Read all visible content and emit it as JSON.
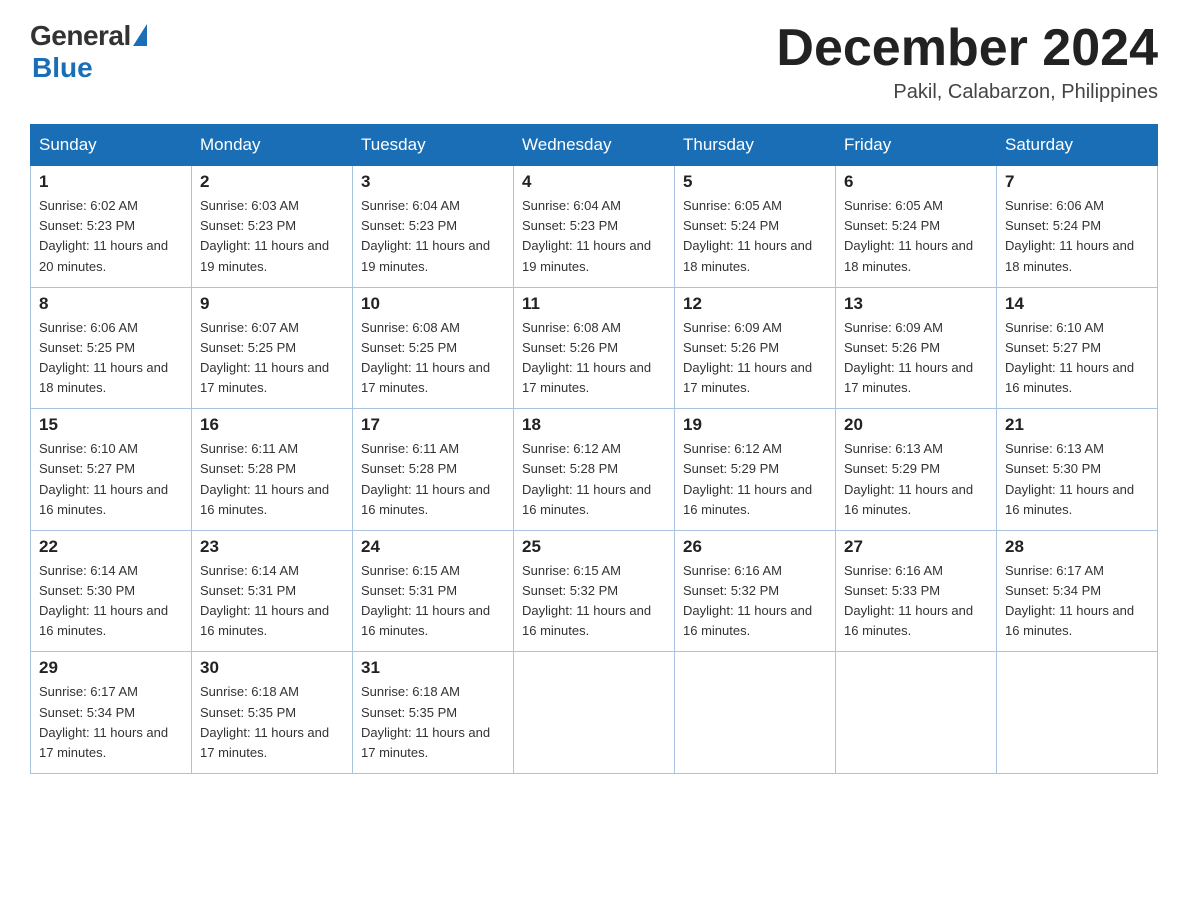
{
  "header": {
    "logo_general": "General",
    "logo_blue": "Blue",
    "month_title": "December 2024",
    "location": "Pakil, Calabarzon, Philippines"
  },
  "days_of_week": [
    "Sunday",
    "Monday",
    "Tuesday",
    "Wednesday",
    "Thursday",
    "Friday",
    "Saturday"
  ],
  "weeks": [
    [
      {
        "day": "1",
        "sunrise": "6:02 AM",
        "sunset": "5:23 PM",
        "daylight": "11 hours and 20 minutes."
      },
      {
        "day": "2",
        "sunrise": "6:03 AM",
        "sunset": "5:23 PM",
        "daylight": "11 hours and 19 minutes."
      },
      {
        "day": "3",
        "sunrise": "6:04 AM",
        "sunset": "5:23 PM",
        "daylight": "11 hours and 19 minutes."
      },
      {
        "day": "4",
        "sunrise": "6:04 AM",
        "sunset": "5:23 PM",
        "daylight": "11 hours and 19 minutes."
      },
      {
        "day": "5",
        "sunrise": "6:05 AM",
        "sunset": "5:24 PM",
        "daylight": "11 hours and 18 minutes."
      },
      {
        "day": "6",
        "sunrise": "6:05 AM",
        "sunset": "5:24 PM",
        "daylight": "11 hours and 18 minutes."
      },
      {
        "day": "7",
        "sunrise": "6:06 AM",
        "sunset": "5:24 PM",
        "daylight": "11 hours and 18 minutes."
      }
    ],
    [
      {
        "day": "8",
        "sunrise": "6:06 AM",
        "sunset": "5:25 PM",
        "daylight": "11 hours and 18 minutes."
      },
      {
        "day": "9",
        "sunrise": "6:07 AM",
        "sunset": "5:25 PM",
        "daylight": "11 hours and 17 minutes."
      },
      {
        "day": "10",
        "sunrise": "6:08 AM",
        "sunset": "5:25 PM",
        "daylight": "11 hours and 17 minutes."
      },
      {
        "day": "11",
        "sunrise": "6:08 AM",
        "sunset": "5:26 PM",
        "daylight": "11 hours and 17 minutes."
      },
      {
        "day": "12",
        "sunrise": "6:09 AM",
        "sunset": "5:26 PM",
        "daylight": "11 hours and 17 minutes."
      },
      {
        "day": "13",
        "sunrise": "6:09 AM",
        "sunset": "5:26 PM",
        "daylight": "11 hours and 17 minutes."
      },
      {
        "day": "14",
        "sunrise": "6:10 AM",
        "sunset": "5:27 PM",
        "daylight": "11 hours and 16 minutes."
      }
    ],
    [
      {
        "day": "15",
        "sunrise": "6:10 AM",
        "sunset": "5:27 PM",
        "daylight": "11 hours and 16 minutes."
      },
      {
        "day": "16",
        "sunrise": "6:11 AM",
        "sunset": "5:28 PM",
        "daylight": "11 hours and 16 minutes."
      },
      {
        "day": "17",
        "sunrise": "6:11 AM",
        "sunset": "5:28 PM",
        "daylight": "11 hours and 16 minutes."
      },
      {
        "day": "18",
        "sunrise": "6:12 AM",
        "sunset": "5:28 PM",
        "daylight": "11 hours and 16 minutes."
      },
      {
        "day": "19",
        "sunrise": "6:12 AM",
        "sunset": "5:29 PM",
        "daylight": "11 hours and 16 minutes."
      },
      {
        "day": "20",
        "sunrise": "6:13 AM",
        "sunset": "5:29 PM",
        "daylight": "11 hours and 16 minutes."
      },
      {
        "day": "21",
        "sunrise": "6:13 AM",
        "sunset": "5:30 PM",
        "daylight": "11 hours and 16 minutes."
      }
    ],
    [
      {
        "day": "22",
        "sunrise": "6:14 AM",
        "sunset": "5:30 PM",
        "daylight": "11 hours and 16 minutes."
      },
      {
        "day": "23",
        "sunrise": "6:14 AM",
        "sunset": "5:31 PM",
        "daylight": "11 hours and 16 minutes."
      },
      {
        "day": "24",
        "sunrise": "6:15 AM",
        "sunset": "5:31 PM",
        "daylight": "11 hours and 16 minutes."
      },
      {
        "day": "25",
        "sunrise": "6:15 AM",
        "sunset": "5:32 PM",
        "daylight": "11 hours and 16 minutes."
      },
      {
        "day": "26",
        "sunrise": "6:16 AM",
        "sunset": "5:32 PM",
        "daylight": "11 hours and 16 minutes."
      },
      {
        "day": "27",
        "sunrise": "6:16 AM",
        "sunset": "5:33 PM",
        "daylight": "11 hours and 16 minutes."
      },
      {
        "day": "28",
        "sunrise": "6:17 AM",
        "sunset": "5:34 PM",
        "daylight": "11 hours and 16 minutes."
      }
    ],
    [
      {
        "day": "29",
        "sunrise": "6:17 AM",
        "sunset": "5:34 PM",
        "daylight": "11 hours and 17 minutes."
      },
      {
        "day": "30",
        "sunrise": "6:18 AM",
        "sunset": "5:35 PM",
        "daylight": "11 hours and 17 minutes."
      },
      {
        "day": "31",
        "sunrise": "6:18 AM",
        "sunset": "5:35 PM",
        "daylight": "11 hours and 17 minutes."
      },
      null,
      null,
      null,
      null
    ]
  ]
}
